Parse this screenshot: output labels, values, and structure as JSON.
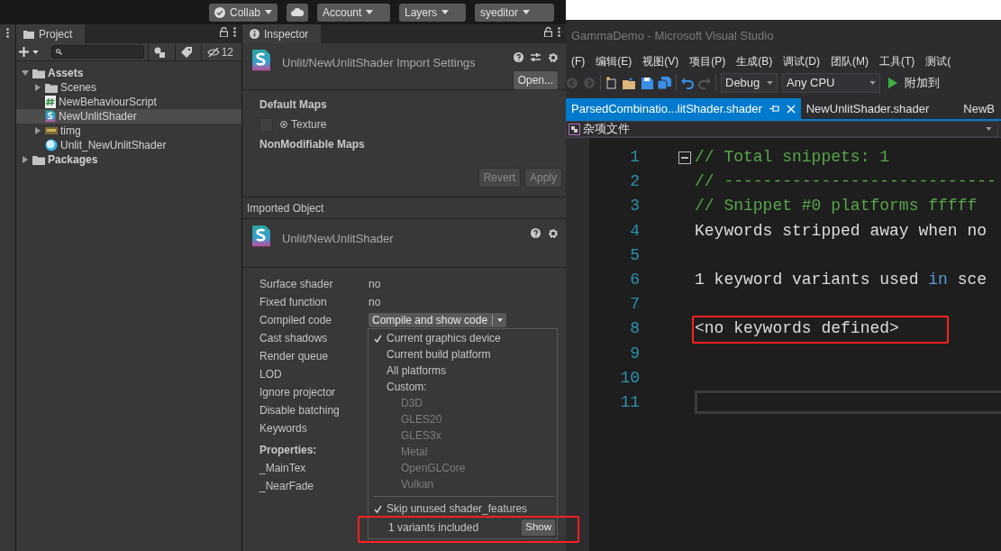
{
  "unity": {
    "toolbar": [
      {
        "label": "Collab",
        "kind": "collab"
      },
      {
        "kind": "cloud"
      },
      {
        "label": "Account",
        "kind": "dropdown"
      },
      {
        "label": "Layers",
        "kind": "dropdown"
      },
      {
        "label": "syeditor",
        "kind": "dropdown"
      }
    ],
    "project": {
      "tab": "Project",
      "hidden_count": "12",
      "tree": [
        {
          "label": "Assets",
          "kind": "folder",
          "expanded": true,
          "selected": false,
          "children": [
            {
              "label": "Scenes",
              "kind": "folder",
              "expanded": false,
              "selected": false
            },
            {
              "label": "NewBehaviourScript",
              "kind": "script",
              "selected": false
            },
            {
              "label": "NewUnlitShader",
              "kind": "shader",
              "selected": true
            },
            {
              "label": "timg",
              "kind": "texture",
              "expanded": false,
              "selected": false
            },
            {
              "label": "Unlit_NewUnlitShader",
              "kind": "material",
              "selected": false
            }
          ]
        },
        {
          "label": "Packages",
          "kind": "folder",
          "expanded": false,
          "selected": false
        }
      ]
    },
    "inspector": {
      "tab": "Inspector",
      "title": "Unlit/NewUnlitShader Import Settings",
      "open_button": "Open...",
      "default_maps": "Default Maps",
      "texture": "Texture",
      "nonmodifiable": "NonModifiable Maps",
      "revert": "Revert",
      "apply": "Apply",
      "imported_header": "Imported Object",
      "object_title": "Unlit/NewUnlitShader",
      "rows": [
        {
          "label": "Surface shader",
          "value": "no"
        },
        {
          "label": "Fixed function",
          "value": "no"
        },
        {
          "label": "Compiled code",
          "button": "Compile and show code"
        },
        {
          "label": "Cast shadows"
        },
        {
          "label": "Render queue"
        },
        {
          "label": "LOD"
        },
        {
          "label": "Ignore projector"
        },
        {
          "label": "Disable batching"
        },
        {
          "label": "Keywords"
        }
      ],
      "properties_header": "Properties:",
      "properties": [
        "_MainTex",
        "_NearFade"
      ],
      "menu": [
        {
          "kind": "item",
          "label": "Current graphics device",
          "checked": true,
          "disabled": false
        },
        {
          "kind": "item",
          "label": "Current build platform",
          "checked": false,
          "disabled": false
        },
        {
          "kind": "item",
          "label": "All platforms",
          "checked": false,
          "disabled": false
        },
        {
          "kind": "item",
          "label": "Custom:",
          "checked": false,
          "disabled": false,
          "children": [
            {
              "label": "D3D",
              "checked": false,
              "disabled": true
            },
            {
              "label": "GLES20",
              "checked": false,
              "disabled": true
            },
            {
              "label": "GLES3x",
              "checked": false,
              "disabled": true
            },
            {
              "label": "Metal",
              "checked": false,
              "disabled": true
            },
            {
              "label": "OpenGLCore",
              "checked": false,
              "disabled": true
            },
            {
              "label": "Vulkan",
              "checked": false,
              "disabled": true
            }
          ]
        },
        {
          "kind": "separator"
        },
        {
          "kind": "item",
          "label": "Skip unused shader_features",
          "checked": true,
          "disabled": false
        },
        {
          "kind": "footer",
          "label": "1 variants included",
          "button": "Show",
          "highlighted": true
        }
      ]
    }
  },
  "vs": {
    "title": "GammaDemo - Microsoft Visual Studio",
    "menu": [
      "(F)",
      "编辑(E)",
      "视图(V)",
      "项目(P)",
      "生成(B)",
      "调试(D)",
      "团队(M)",
      "工具(T)",
      "测试("
    ],
    "config": "Debug",
    "platform": "Any CPU",
    "run": "附加到",
    "tabs": [
      {
        "label": "ParsedCombinatio...litShader.shader",
        "selected": true
      },
      {
        "label": "NewUnlitShader.shader",
        "selected": false
      },
      {
        "label": "NewB",
        "selected": false
      }
    ],
    "nav": "杂项文件",
    "lines": [
      {
        "number": "1",
        "fold": true,
        "tokens": [
          {
            "text": "// Total snippets: 1",
            "kind": "comment"
          }
        ]
      },
      {
        "number": "2",
        "tokens": [
          {
            "text": "// ----------------------------",
            "kind": "comment"
          }
        ]
      },
      {
        "number": "3",
        "tokens": [
          {
            "text": "// Snippet #0 platforms fffff",
            "kind": "comment"
          }
        ]
      },
      {
        "number": "4",
        "tokens": [
          {
            "text": "Keywords stripped away when no",
            "kind": "plain"
          }
        ]
      },
      {
        "number": "5"
      },
      {
        "number": "6",
        "tokens": [
          {
            "text": "1 keyword variants used ",
            "kind": "plain"
          },
          {
            "text": "in",
            "kind": "keyword"
          },
          {
            "text": " sce",
            "kind": "plain"
          }
        ]
      },
      {
        "number": "7"
      },
      {
        "number": "8",
        "highlighted": true,
        "tokens": [
          {
            "text": "<no keywords defined>",
            "kind": "plain"
          }
        ]
      },
      {
        "number": "9"
      },
      {
        "number": "10"
      },
      {
        "number": "11",
        "outlined": true
      }
    ]
  }
}
